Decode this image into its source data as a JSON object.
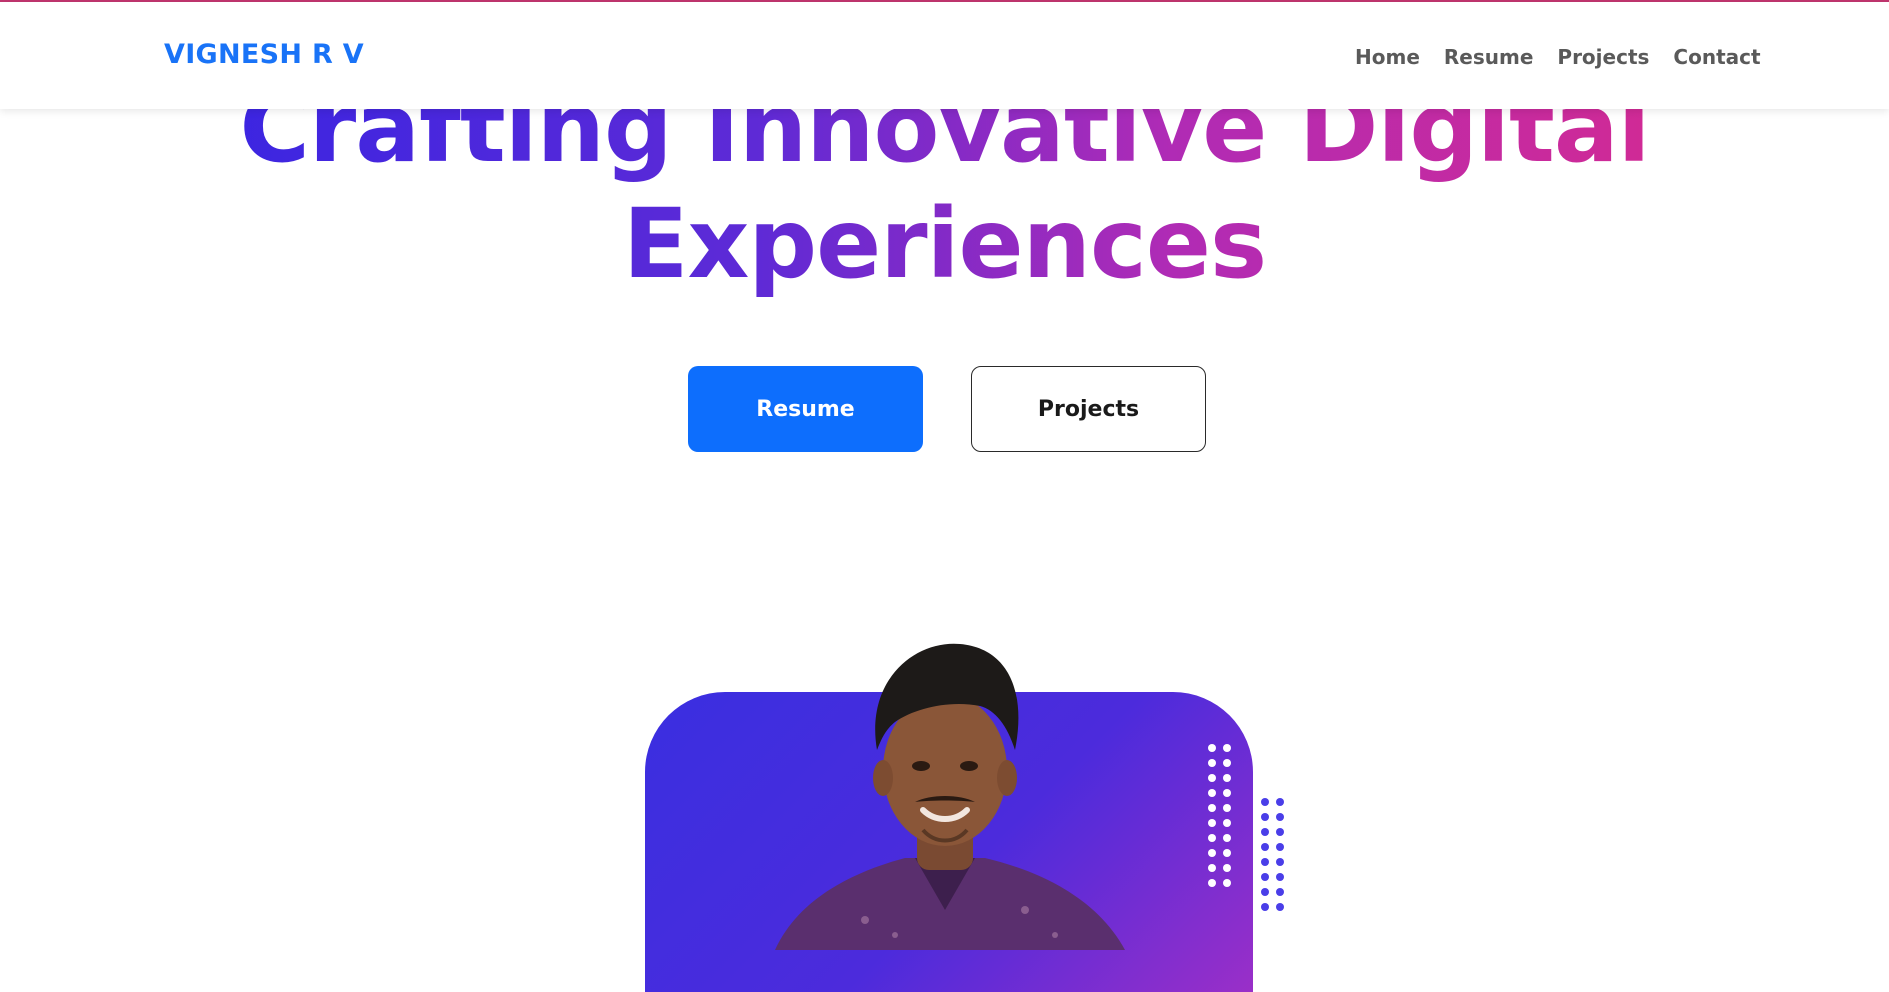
{
  "brand": {
    "name": "VIGNESH R V"
  },
  "nav": {
    "items": [
      "Home",
      "Resume",
      "Projects",
      "Contact"
    ]
  },
  "hero": {
    "title_line1": "Crafting Innovative Digital",
    "title_line2": "Experiences",
    "resume_button": "Resume",
    "projects_button": "Projects"
  },
  "colors": {
    "accent": "#0d6efd",
    "brand": "#1973f7",
    "gradient_start": "#2d23e6",
    "gradient_end": "#e02a86"
  },
  "image": {
    "alt": "Profile photo"
  }
}
